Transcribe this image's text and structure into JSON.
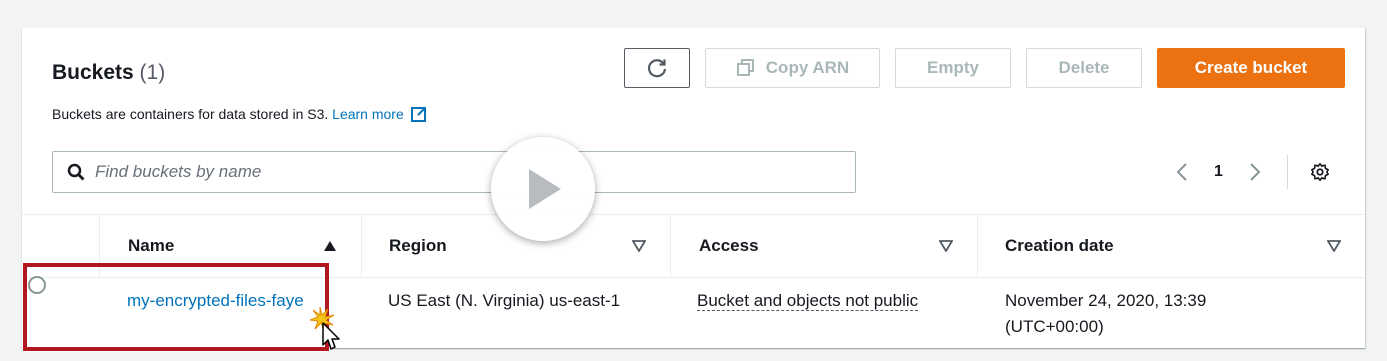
{
  "header": {
    "title": "Buckets",
    "count": "(1)",
    "description": "Buckets are containers for data stored in S3.",
    "learn_more": "Learn more"
  },
  "toolbar": {
    "refresh_icon": "refresh-icon",
    "copy_arn_label": "Copy ARN",
    "empty_label": "Empty",
    "delete_label": "Delete",
    "create_label": "Create bucket",
    "accent_color": "#ec7211"
  },
  "search": {
    "placeholder": "Find buckets by name",
    "value": ""
  },
  "pagination": {
    "current_page": "1"
  },
  "table": {
    "columns": [
      "Name",
      "Region",
      "Access",
      "Creation date"
    ],
    "rows": [
      {
        "name": "my-encrypted-files-faye",
        "region": "US East (N. Virginia) us-east-1",
        "access": "Bucket and objects not public",
        "creation_date": "November 24, 2020, 13:39 (UTC+00:00)"
      }
    ]
  }
}
